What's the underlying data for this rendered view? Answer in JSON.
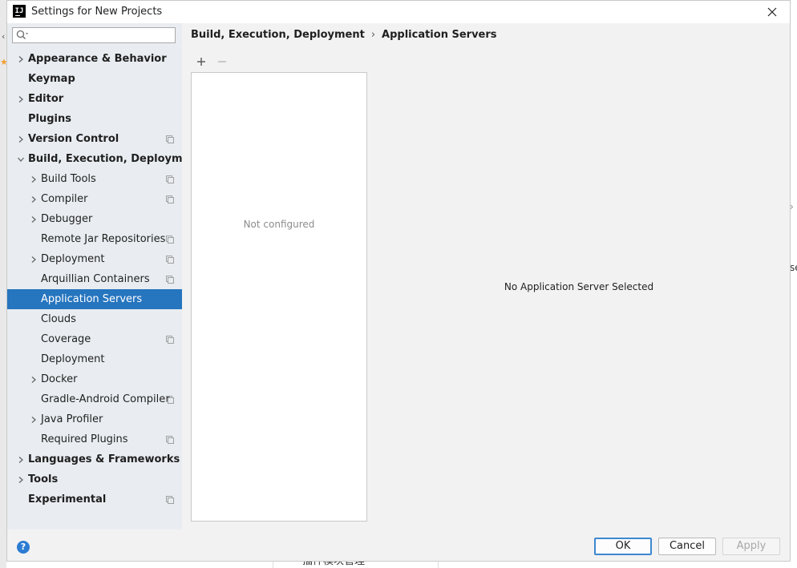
{
  "window": {
    "title": "Settings for New Projects",
    "app_icon_text": "IJ"
  },
  "search": {
    "placeholder": "",
    "value": ""
  },
  "sidebar": {
    "items": [
      {
        "label": "Appearance & Behavior",
        "level": 0,
        "bold": true,
        "chevron": "right",
        "project_icon": false,
        "selected": false
      },
      {
        "label": "Keymap",
        "level": 0,
        "bold": true,
        "chevron": "none",
        "project_icon": false,
        "selected": false
      },
      {
        "label": "Editor",
        "level": 0,
        "bold": true,
        "chevron": "right",
        "project_icon": false,
        "selected": false
      },
      {
        "label": "Plugins",
        "level": 0,
        "bold": true,
        "chevron": "none",
        "project_icon": false,
        "selected": false
      },
      {
        "label": "Version Control",
        "level": 0,
        "bold": true,
        "chevron": "right",
        "project_icon": true,
        "selected": false
      },
      {
        "label": "Build, Execution, Deployment",
        "level": 0,
        "bold": true,
        "chevron": "down",
        "project_icon": false,
        "selected": false
      },
      {
        "label": "Build Tools",
        "level": 1,
        "bold": false,
        "chevron": "right",
        "project_icon": true,
        "selected": false
      },
      {
        "label": "Compiler",
        "level": 1,
        "bold": false,
        "chevron": "right",
        "project_icon": true,
        "selected": false
      },
      {
        "label": "Debugger",
        "level": 1,
        "bold": false,
        "chevron": "right",
        "project_icon": false,
        "selected": false
      },
      {
        "label": "Remote Jar Repositories",
        "level": 1,
        "bold": false,
        "chevron": "none",
        "project_icon": true,
        "selected": false
      },
      {
        "label": "Deployment",
        "level": 1,
        "bold": false,
        "chevron": "right",
        "project_icon": true,
        "selected": false
      },
      {
        "label": "Arquillian Containers",
        "level": 1,
        "bold": false,
        "chevron": "none",
        "project_icon": true,
        "selected": false
      },
      {
        "label": "Application Servers",
        "level": 1,
        "bold": false,
        "chevron": "none",
        "project_icon": false,
        "selected": true
      },
      {
        "label": "Clouds",
        "level": 1,
        "bold": false,
        "chevron": "none",
        "project_icon": false,
        "selected": false
      },
      {
        "label": "Coverage",
        "level": 1,
        "bold": false,
        "chevron": "none",
        "project_icon": true,
        "selected": false
      },
      {
        "label": "Deployment",
        "level": 1,
        "bold": false,
        "chevron": "none",
        "project_icon": false,
        "selected": false
      },
      {
        "label": "Docker",
        "level": 1,
        "bold": false,
        "chevron": "right",
        "project_icon": false,
        "selected": false
      },
      {
        "label": "Gradle-Android Compiler",
        "level": 1,
        "bold": false,
        "chevron": "none",
        "project_icon": true,
        "selected": false
      },
      {
        "label": "Java Profiler",
        "level": 1,
        "bold": false,
        "chevron": "right",
        "project_icon": false,
        "selected": false
      },
      {
        "label": "Required Plugins",
        "level": 1,
        "bold": false,
        "chevron": "none",
        "project_icon": true,
        "selected": false
      },
      {
        "label": "Languages & Frameworks",
        "level": 0,
        "bold": true,
        "chevron": "right",
        "project_icon": false,
        "selected": false
      },
      {
        "label": "Tools",
        "level": 0,
        "bold": true,
        "chevron": "right",
        "project_icon": false,
        "selected": false
      },
      {
        "label": "Experimental",
        "level": 0,
        "bold": true,
        "chevron": "none",
        "project_icon": true,
        "selected": false
      }
    ]
  },
  "main": {
    "breadcrumb": {
      "parent": "Build, Execution, Deployment",
      "separator": "›",
      "current": "Application Servers"
    },
    "toolbar": {
      "add_icon": "plus-icon",
      "remove_icon": "minus-icon"
    },
    "list_empty_text": "Not configured",
    "detail_empty_text": "No Application Server Selected"
  },
  "footer": {
    "help_label": "?",
    "ok_label": "OK",
    "cancel_label": "Cancel",
    "apply_label": "Apply"
  },
  "background": {
    "partial_text_right": "se",
    "partial_text_bottom": "插件模块管理"
  },
  "colors": {
    "selection": "#2675bf",
    "sidebar_bg": "#e9edf1",
    "dialog_bg": "#f2f2f2",
    "default_button_border": "#3d88d1",
    "help_icon": "#2b7cd3"
  }
}
